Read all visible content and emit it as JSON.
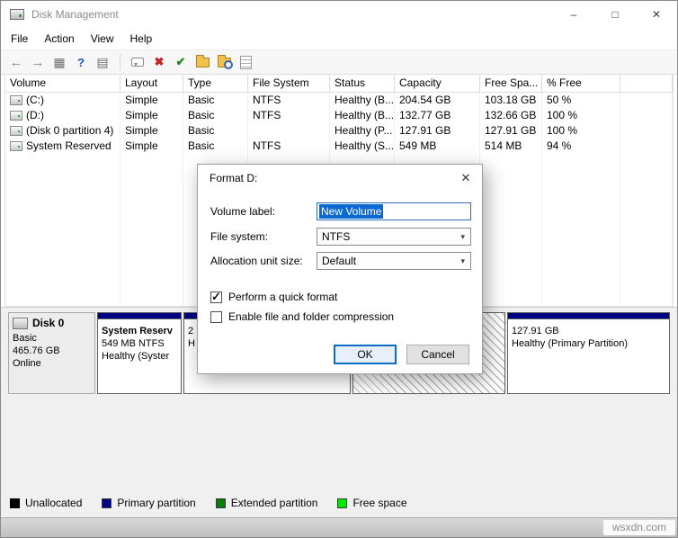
{
  "window": {
    "title": "Disk Management",
    "minimize": "–",
    "maximize": "□",
    "close": "✕"
  },
  "menu": {
    "file": "File",
    "action": "Action",
    "view": "View",
    "help": "Help"
  },
  "toolbar": {
    "icons": [
      {
        "name": "back-icon",
        "glyph": "←"
      },
      {
        "name": "forward-icon",
        "glyph": "→"
      },
      {
        "name": "console-tree-icon",
        "glyph": "▦"
      },
      {
        "name": "help-icon",
        "glyph": "?"
      },
      {
        "name": "action-pane-icon",
        "glyph": "▤"
      },
      {
        "name": "comment-icon",
        "glyph": ""
      },
      {
        "name": "delete-icon",
        "glyph": "✖"
      },
      {
        "name": "check-document-icon",
        "glyph": "✔"
      },
      {
        "name": "open-folder-icon",
        "glyph": ""
      },
      {
        "name": "find-icon",
        "glyph": ""
      },
      {
        "name": "properties-icon",
        "glyph": ""
      }
    ]
  },
  "icons": {
    "chevron_down": "▾"
  },
  "volume_table": {
    "columns": [
      "Volume",
      "Layout",
      "Type",
      "File System",
      "Status",
      "Capacity",
      "Free Spa...",
      "% Free"
    ],
    "rows": [
      {
        "volume": "(C:)",
        "layout": "Simple",
        "type": "Basic",
        "file_system": "NTFS",
        "status": "Healthy (B...",
        "capacity": "204.54 GB",
        "free_space": "103.18 GB",
        "pct_free": "50 %"
      },
      {
        "volume": "(D:)",
        "layout": "Simple",
        "type": "Basic",
        "file_system": "NTFS",
        "status": "Healthy (B...",
        "capacity": "132.77 GB",
        "free_space": "132.66 GB",
        "pct_free": "100 %"
      },
      {
        "volume": "(Disk 0 partition 4)",
        "layout": "Simple",
        "type": "Basic",
        "file_system": "",
        "status": "Healthy (P...",
        "capacity": "127.91 GB",
        "free_space": "127.91 GB",
        "pct_free": "100 %"
      },
      {
        "volume": "System Reserved",
        "layout": "Simple",
        "type": "Basic",
        "file_system": "NTFS",
        "status": "Healthy (S...",
        "capacity": "549 MB",
        "free_space": "514 MB",
        "pct_free": "94 %"
      }
    ]
  },
  "dialog": {
    "title": "Format D:",
    "close": "✕",
    "fields": {
      "volume_label": {
        "label": "Volume label:",
        "value": "New Volume"
      },
      "file_system": {
        "label": "File system:",
        "value": "NTFS"
      },
      "allocation_unit": {
        "label": "Allocation unit size:",
        "value": "Default"
      }
    },
    "checkboxes": {
      "quick_format": {
        "label": "Perform a quick format",
        "checked": true
      },
      "compression": {
        "label": "Enable file and folder compression",
        "checked": false
      }
    },
    "buttons": {
      "ok": "OK",
      "cancel": "Cancel"
    }
  },
  "disk_view": {
    "disk": {
      "name": "Disk 0",
      "type": "Basic",
      "size": "465.76 GB",
      "status": "Online"
    },
    "partitions": [
      {
        "line1": "System Reserv",
        "line2": "549 MB NTFS",
        "line3": "Healthy (Syster"
      },
      {
        "line1": "",
        "line2": "2",
        "line3": "H"
      },
      {
        "line1": "",
        "line2": "",
        "line3": ""
      },
      {
        "line1": "",
        "line2": "127.91 GB",
        "line3": "Healthy (Primary Partition)"
      }
    ]
  },
  "legend": {
    "items": [
      {
        "label": "Unallocated",
        "color": "#000000"
      },
      {
        "label": "Primary partition",
        "color": "#000082"
      },
      {
        "label": "Extended partition",
        "color": "#008200"
      },
      {
        "label": "Free space",
        "color": "#00e400"
      }
    ]
  },
  "watermark": {
    "text": "wsxdn.com"
  }
}
